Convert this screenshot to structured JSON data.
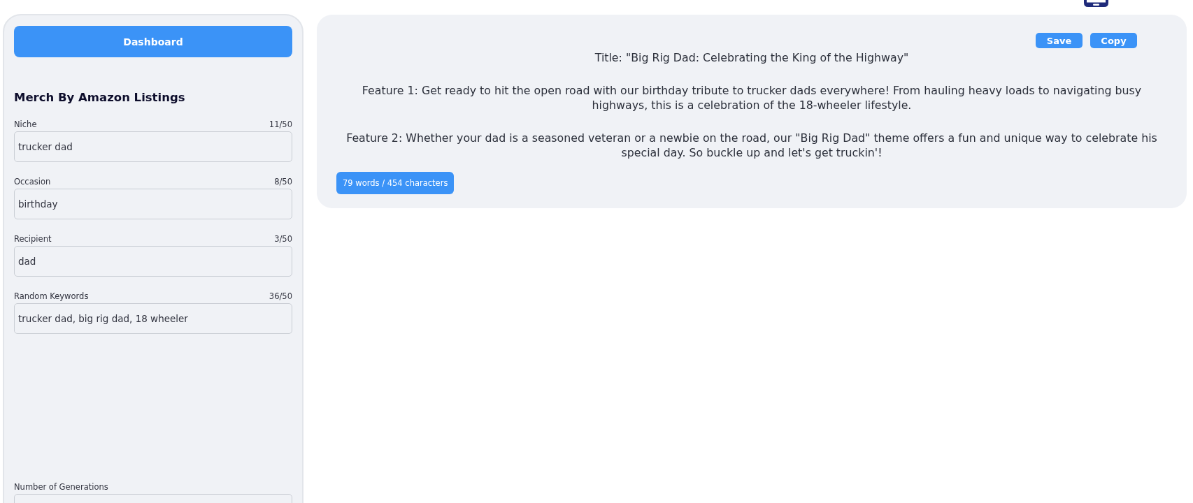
{
  "sidebar": {
    "dashboard_button": "Dashboard",
    "heading": "Merch By Amazon Listings",
    "fields": [
      {
        "label": "Niche",
        "count": "11/50",
        "value": "trucker dad"
      },
      {
        "label": "Occasion",
        "count": "8/50",
        "value": "birthday"
      },
      {
        "label": "Recipient",
        "count": "3/50",
        "value": "dad"
      },
      {
        "label": "Random Keywords",
        "count": "36/50",
        "value": "trucker dad, big rig dad, 18 wheeler"
      }
    ],
    "generations": {
      "label": "Number of Generations"
    }
  },
  "output": {
    "buttons": [
      "Save",
      "Copy"
    ],
    "paragraphs": [
      "Title: \"Big Rig Dad: Celebrating the King of the Highway\"",
      "Feature 1: Get ready to hit the open road with our birthday tribute to trucker dads everywhere! From hauling heavy loads to navigating busy highways, this is a celebration of the 18-wheeler lifestyle.",
      "Feature 2: Whether your dad is a seasoned veteran or a newbie on the road, our \"Big Rig Dad\" theme offers a fun and unique way to celebrate his special day. So buckle up and let's get truckin'!"
    ],
    "stats": "79 words / 454 characters"
  }
}
